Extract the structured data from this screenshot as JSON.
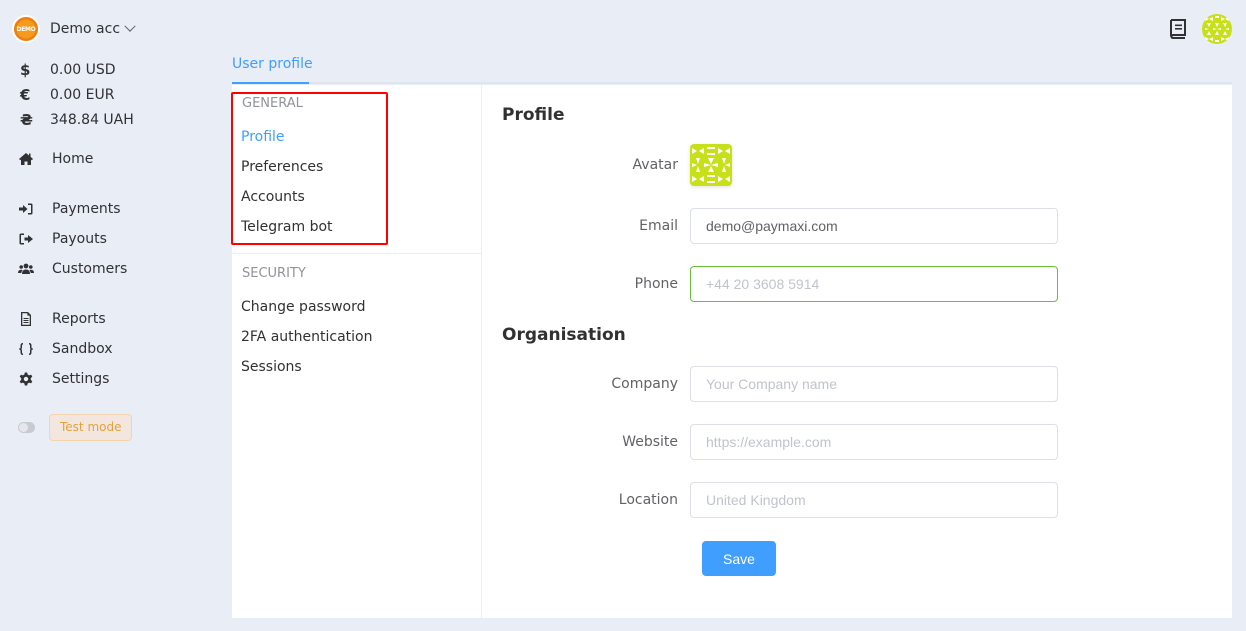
{
  "account": {
    "logo_text": "DEMO",
    "name": "Demo acc"
  },
  "balances": [
    {
      "symbol": "$",
      "amount": "0.00 USD"
    },
    {
      "symbol": "€",
      "amount": "0.00 EUR"
    },
    {
      "symbol": "₴",
      "amount": "348.84 UAH"
    }
  ],
  "nav": {
    "home": "Home",
    "payments": "Payments",
    "payouts": "Payouts",
    "customers": "Customers",
    "reports": "Reports",
    "sandbox": "Sandbox",
    "settings": "Settings"
  },
  "test_mode": {
    "label": "Test mode",
    "enabled": false
  },
  "tabs": [
    {
      "label": "User profile",
      "active": true
    }
  ],
  "submenu": {
    "general": {
      "title": "GENERAL",
      "items": [
        "Profile",
        "Preferences",
        "Accounts",
        "Telegram bot"
      ],
      "active": "Profile"
    },
    "security": {
      "title": "SECURITY",
      "items": [
        "Change password",
        "2FA authentication",
        "Sessions"
      ]
    }
  },
  "profile": {
    "title": "Profile",
    "avatar_label": "Avatar",
    "email_label": "Email",
    "email_value": "demo@paymaxi.com",
    "phone_label": "Phone",
    "phone_placeholder": "+44 20 3608 5914"
  },
  "organisation": {
    "title": "Organisation",
    "company_label": "Company",
    "company_placeholder": "Your Company name",
    "website_label": "Website",
    "website_placeholder": "https://example.com",
    "location_label": "Location",
    "location_placeholder": "United Kingdom"
  },
  "save_label": "Save",
  "colors": {
    "accent": "#409eff",
    "focus_border": "#67c23a",
    "highlight": "#ff0000",
    "test_mode": "#e6a23c",
    "avatar_pattern": "#c8e01a"
  }
}
